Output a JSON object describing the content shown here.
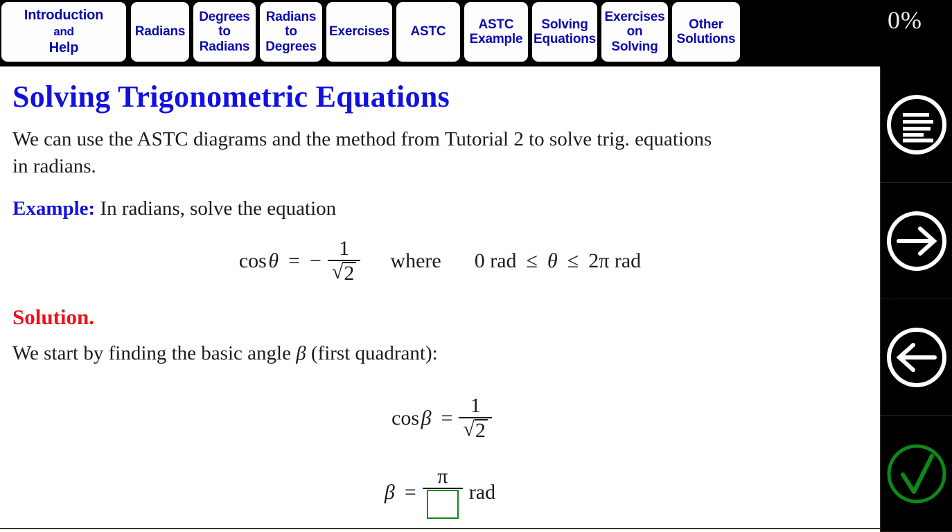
{
  "app": {
    "background_color": "#000000",
    "page_background": "#ffffff",
    "accent_blue": "#1111e0",
    "accent_red": "#e8121a",
    "accent_green": "#0b8a17",
    "tab_text_color": "#0a0aab",
    "rule_color": "#3f3222"
  },
  "tabs": [
    {
      "id": "introduction-and-help",
      "line1": "Introduction",
      "line2": "and",
      "line3": "Help",
      "label": "Introduction and Help"
    },
    {
      "id": "radians",
      "label": "Radians"
    },
    {
      "id": "degrees-to-radians",
      "label": "Degrees\nto\nRadians"
    },
    {
      "id": "radians-to-degrees",
      "label": "Radians\nto\nDegrees"
    },
    {
      "id": "exercises",
      "label": "Exercises"
    },
    {
      "id": "astc",
      "label": "ASTC"
    },
    {
      "id": "astc-example",
      "label": "ASTC\nExample"
    },
    {
      "id": "solving-equations",
      "label": "Solving\nEquations"
    },
    {
      "id": "exercises-on-solving",
      "label": "Exercises\non\nSolving"
    },
    {
      "id": "other-solutions",
      "label": "Other\nSolutions"
    }
  ],
  "progress": {
    "label": "0%",
    "value": 0
  },
  "content": {
    "title": "Solving Trigonometric Equations",
    "intro_paragraph": "We can use the ASTC diagrams and the method from Tutorial 2 to solve trig. equations in radians.",
    "example_keyword": "Example:",
    "example_text": "In radians, solve the equation",
    "solution_heading": "Solution.",
    "solution_text_before": "We start by finding the basic angle",
    "solution_variable": "β",
    "solution_text_after": "(first quadrant):",
    "equation_1": {
      "lhs_function": "cos",
      "lhs_variable": "θ",
      "relation": "=",
      "sign": "−",
      "numerator": "1",
      "denominator_radical": "√",
      "denominator_radicand": "2",
      "condition_word": "where",
      "condition_lower": "0 rad",
      "condition_rel1": "≤",
      "condition_variable": "θ",
      "condition_rel2": "≤",
      "condition_upper": "2π rad",
      "plain": "cos θ = −1/√2   where   0 rad ≤ θ ≤ 2π rad"
    },
    "equation_2": {
      "lhs_function": "cos",
      "lhs_variable": "β",
      "relation": "=",
      "numerator": "1",
      "denominator_radical": "√",
      "denominator_radicand": "2",
      "plain": "cos β = 1/√2"
    },
    "equation_3": {
      "lhs_variable": "β",
      "relation": "=",
      "numerator": "π",
      "denominator_input_value": "",
      "unit": "rad",
      "plain": "β = π/[  ] rad"
    }
  },
  "sidebar": {
    "items": [
      {
        "id": "menu",
        "icon": "menu-lines-icon",
        "color": "#ffffff"
      },
      {
        "id": "next",
        "icon": "arrow-right-icon",
        "color": "#ffffff"
      },
      {
        "id": "previous",
        "icon": "arrow-left-icon",
        "color": "#ffffff"
      },
      {
        "id": "check-answer",
        "icon": "check-mark-icon",
        "color": "#0b8a17"
      }
    ]
  }
}
